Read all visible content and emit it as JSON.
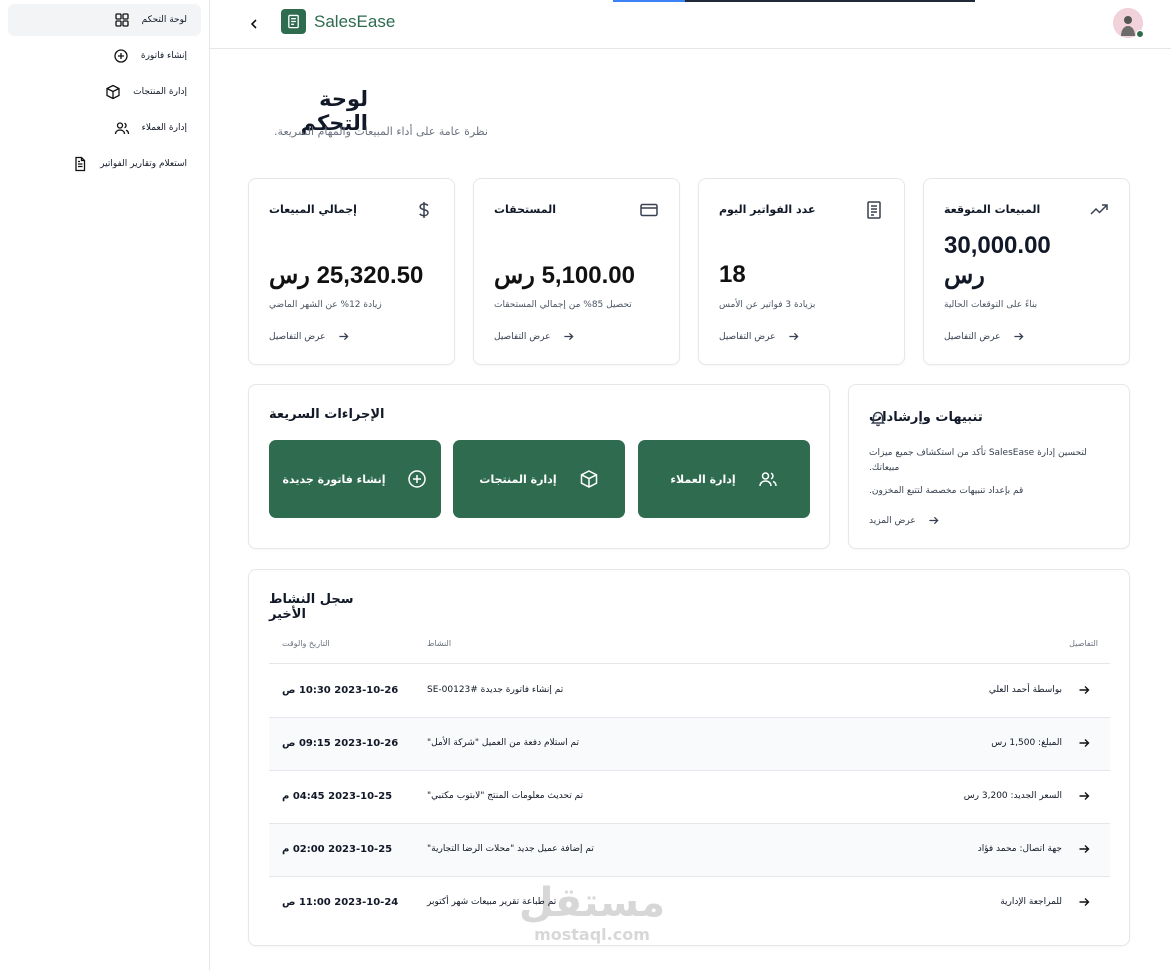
{
  "sidebar": {
    "items": [
      {
        "label": "لوحة التحكم",
        "icon": "dashboard-grid-icon"
      },
      {
        "label": "إنشاء فاتورة",
        "icon": "plus-circle-icon"
      },
      {
        "label": "إدارة المنتجات",
        "icon": "box-icon"
      },
      {
        "label": "إدارة العملاء",
        "icon": "users-icon"
      },
      {
        "label": "استعلام وتقارير الفواتير",
        "icon": "document-icon"
      }
    ]
  },
  "header": {
    "brand": "SalesEase",
    "back_icon": "chevron-left-icon",
    "brand_color": "#2e6b4f"
  },
  "page": {
    "title": "لوحة التحكم",
    "subtitle": "نظرة عامة على أداء المبيعات والمهام السريعة."
  },
  "stats": [
    {
      "title": "إجمالي المبيعات",
      "value": "25,320.50 رس",
      "note": "زيادة 12% عن الشهر الماضي",
      "link": "عرض التفاصيل",
      "icon": "dollar-icon"
    },
    {
      "title": "المستحقات",
      "value": "5,100.00 رس",
      "note": "تحصيل 85% من إجمالي المستحقات",
      "link": "عرض التفاصيل",
      "icon": "credit-card-icon"
    },
    {
      "title": "عدد الفواتير اليوم",
      "value": "18",
      "note": "بزيادة 3 فواتير عن الأمس",
      "link": "عرض التفاصيل",
      "icon": "receipt-icon"
    },
    {
      "title": "المبيعات المتوقعة",
      "value_line1": "30,000.00",
      "value_line2": "رس",
      "note": "بناءً على التوقعات الحالية",
      "link": "عرض التفاصيل",
      "icon": "trending-up-icon"
    }
  ],
  "quick_actions": {
    "title": "الإجراءات السريعة",
    "buttons": [
      {
        "label": "إنشاء فاتورة جديدة",
        "icon": "plus-circle-icon"
      },
      {
        "label": "إدارة المنتجات",
        "icon": "box-icon"
      },
      {
        "label": "إدارة العملاء",
        "icon": "users-icon"
      }
    ]
  },
  "alerts": {
    "title": "تنبيهات وإرشادات",
    "line1": "لتحسين إدارة SalesEase تأكد من استكشاف جميع ميزات",
    "line2": "مبيعاتك.",
    "line3": "قم بإعداد تنبيهات مخصصة لتتبع المخزون.",
    "link": "عرض المزيد",
    "icon": "bell-icon"
  },
  "activity": {
    "title": "سجل النشاط الأخير",
    "columns": {
      "date": "التاريخ والوقت",
      "activity": "النشاط",
      "details": "التفاصيل"
    },
    "rows": [
      {
        "date": "2023-10-26 10:30 ص",
        "activity": "تم إنشاء فاتورة جديدة #SE-00123",
        "details": "بواسطة أحمد العلي"
      },
      {
        "date": "2023-10-26 09:15 ص",
        "activity": "تم استلام دفعة من العميل \"شركة الأمل\"",
        "details": "المبلغ: 1,500 رس"
      },
      {
        "date": "2023-10-25 04:45 م",
        "activity": "تم تحديث معلومات المنتج \"لابتوب مكتبي\"",
        "details": "السعر الجديد: 3,200 رس"
      },
      {
        "date": "2023-10-25 02:00 م",
        "activity": "تم إضافة عميل جديد \"محلات الرضا التجارية\"",
        "details": "جهة اتصال: محمد فؤاد"
      },
      {
        "date": "2023-10-24 11:00 ص",
        "activity": "تم طباعة تقرير مبيعات شهر أكتوبر",
        "details": "للمراجعة الإدارية"
      }
    ]
  },
  "watermark": {
    "text": "مستقل",
    "sub": "mostaql.com"
  }
}
